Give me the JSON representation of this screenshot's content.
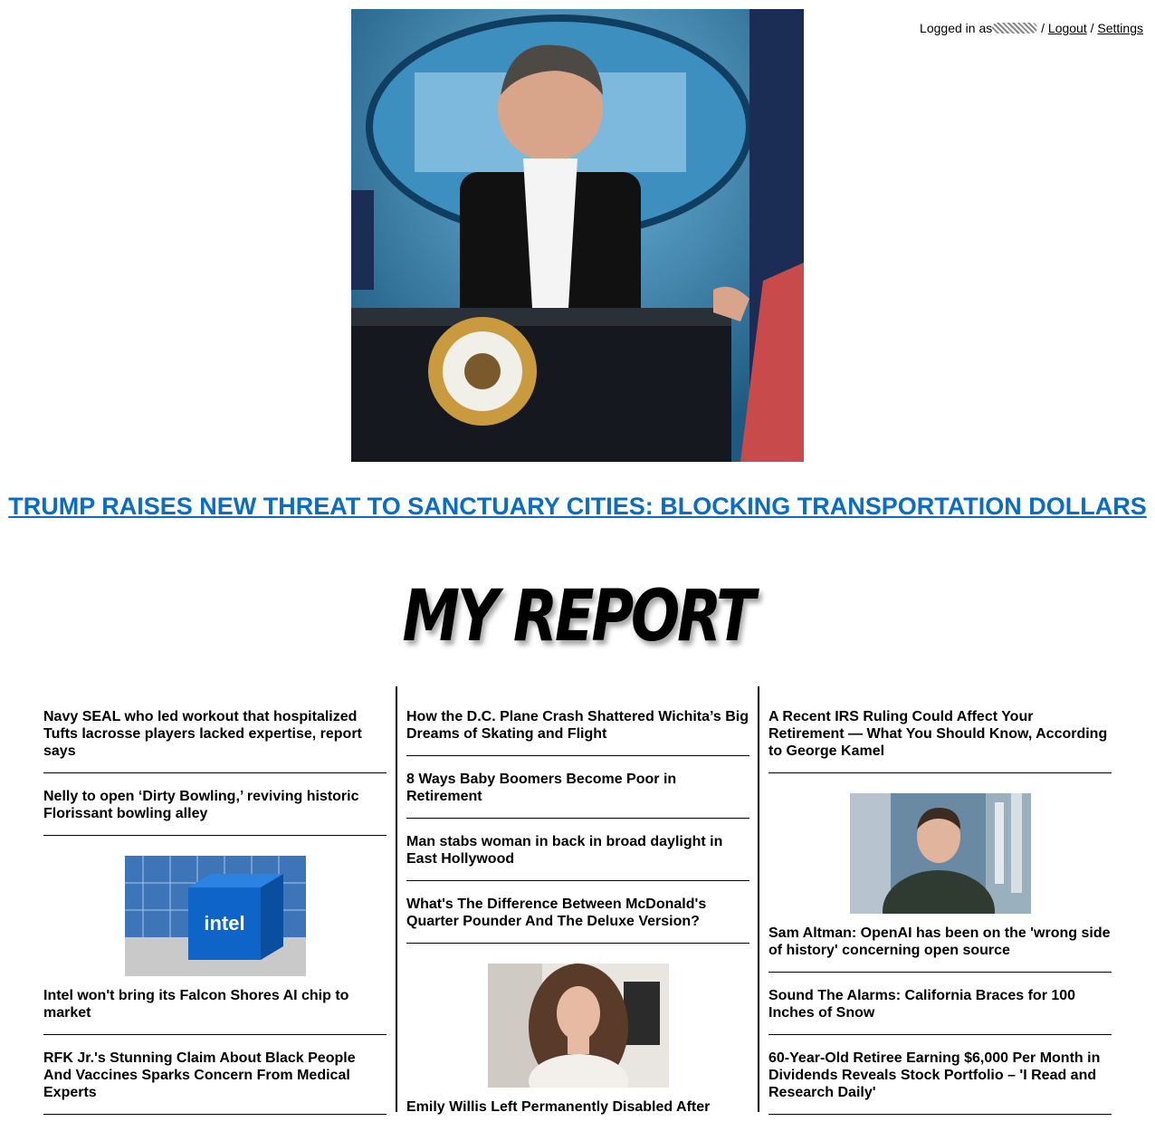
{
  "userbar": {
    "logged_in_text": "Logged in as",
    "logout_label": "Logout",
    "separator": "/",
    "settings_label": "Settings"
  },
  "hero": {
    "image": "press-briefing-photo-icon",
    "headline": "TRUMP RAISES NEW THREAT TO SANCTUARY CITIES: BLOCKING TRANSPORTATION DOLLARS"
  },
  "logo": {
    "text": "MY REPORT"
  },
  "columns": [
    {
      "items": [
        {
          "title": "Navy SEAL who led workout that hospitalized Tufts lacrosse players lacked expertise, report says"
        },
        {
          "title": "Nelly to open ‘Dirty Bowling,’ reviving historic Florissant bowling alley"
        },
        {
          "title": "Intel won't bring its Falcon Shores AI chip to market",
          "image": "intel-cube-photo-icon"
        },
        {
          "title": "RFK Jr.'s Stunning Claim About Black People And Vaccines Sparks Concern From Medical Experts"
        }
      ]
    },
    {
      "items": [
        {
          "title": "How the D.C. Plane Crash Shattered Wichita’s Big Dreams of Skating and Flight"
        },
        {
          "title": "8 Ways Baby Boomers Become Poor in Retirement"
        },
        {
          "title": "Man stabs woman in back in broad daylight in East Hollywood"
        },
        {
          "title": "What's The Difference Between McDonald's Quarter Pounder And The Deluxe Version?"
        },
        {
          "title": "Emily Willis Left Permanently Disabled After",
          "image": "portrait-photo-icon"
        }
      ]
    },
    {
      "items": [
        {
          "title": "A Recent IRS Ruling Could Affect Your Retirement — What You Should Know, According to George Kamel"
        },
        {
          "title": "Sam Altman: OpenAI has been on the 'wrong side of history' concerning open source",
          "image": "interview-photo-icon"
        },
        {
          "title": "Sound The Alarms: California Braces for 100 Inches of Snow"
        },
        {
          "title": "60-Year-Old Retiree Earning $6,000 Per Month in Dividends Reveals Stock Portfolio – 'I Read and Research Daily'"
        }
      ]
    }
  ]
}
